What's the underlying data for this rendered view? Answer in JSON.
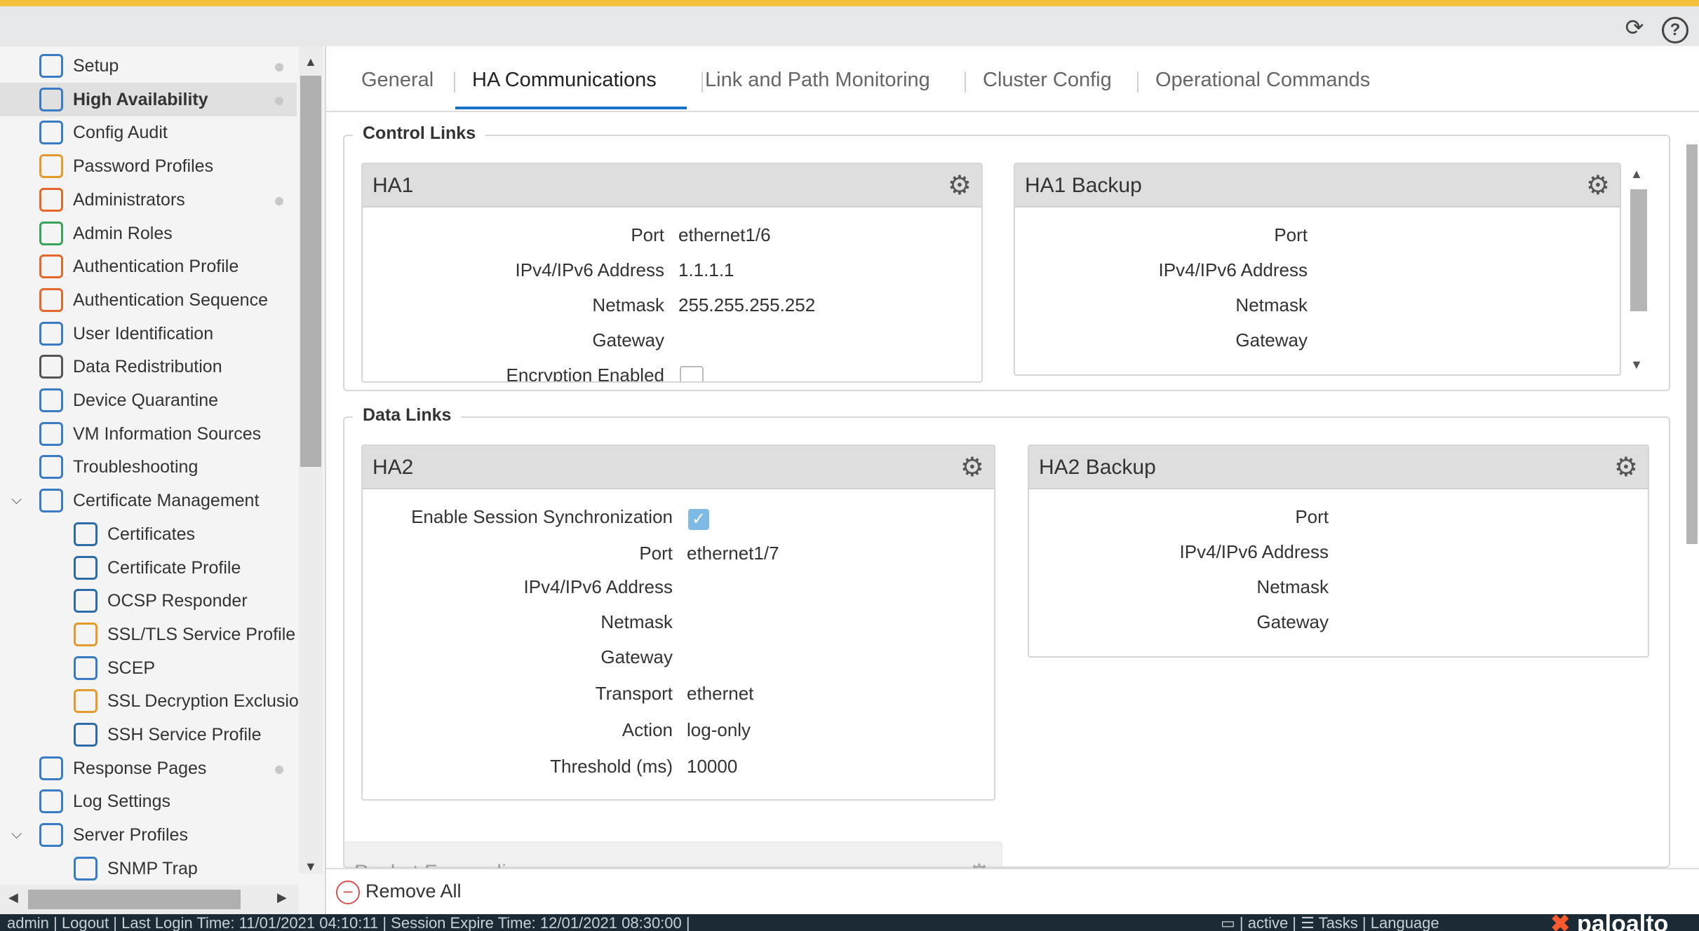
{
  "sidebar": {
    "items": [
      {
        "label": "Setup",
        "icon": "setup-icon",
        "color": "#3a7cc4",
        "dot": true
      },
      {
        "label": "High Availability",
        "icon": "high-availability-icon",
        "color": "#3a7cc4",
        "dot": true,
        "active": true
      },
      {
        "label": "Config Audit",
        "icon": "config-audit-icon",
        "color": "#3a7cc4"
      },
      {
        "label": "Password Profiles",
        "icon": "password-profiles-icon",
        "color": "#e59b2b"
      },
      {
        "label": "Administrators",
        "icon": "administrators-icon",
        "color": "#e5672b",
        "dot": true
      },
      {
        "label": "Admin Roles",
        "icon": "admin-roles-icon",
        "color": "#3aa35a"
      },
      {
        "label": "Authentication Profile",
        "icon": "authentication-profile-icon",
        "color": "#e5672b"
      },
      {
        "label": "Authentication Sequence",
        "icon": "authentication-sequence-icon",
        "color": "#e5672b"
      },
      {
        "label": "User Identification",
        "icon": "user-identification-icon",
        "color": "#3a7cc4"
      },
      {
        "label": "Data Redistribution",
        "icon": "data-redistribution-icon",
        "color": "#555555"
      },
      {
        "label": "Device Quarantine",
        "icon": "device-quarantine-icon",
        "color": "#3a7cc4"
      },
      {
        "label": "VM Information Sources",
        "icon": "vm-information-sources-icon",
        "color": "#3a7cc4"
      },
      {
        "label": "Troubleshooting",
        "icon": "troubleshooting-icon",
        "color": "#3a7cc4"
      },
      {
        "label": "Certificate Management",
        "icon": "certificate-management-icon",
        "color": "#3a7cc4",
        "caret": "⌵"
      },
      {
        "label": "Certificates",
        "icon": "certificates-icon",
        "color": "#2e6ca8",
        "indent": true
      },
      {
        "label": "Certificate Profile",
        "icon": "certificate-profile-icon",
        "color": "#2e6ca8",
        "indent": true
      },
      {
        "label": "OCSP Responder",
        "icon": "ocsp-responder-icon",
        "color": "#2e6ca8",
        "indent": true
      },
      {
        "label": "SSL/TLS Service Profile",
        "icon": "ssl-tls-lock-icon",
        "color": "#e59b2b",
        "indent": true
      },
      {
        "label": "SCEP",
        "icon": "scep-icon",
        "color": "#3a7cc4",
        "indent": true
      },
      {
        "label": "SSL Decryption Exclusio",
        "icon": "ssl-decryption-lock-icon",
        "color": "#e59b2b",
        "indent": true
      },
      {
        "label": "SSH Service Profile",
        "icon": "ssh-service-profile-icon",
        "color": "#2e6ca8",
        "indent": true
      },
      {
        "label": "Response Pages",
        "icon": "response-pages-icon",
        "color": "#3a7cc4",
        "dot": true
      },
      {
        "label": "Log Settings",
        "icon": "log-settings-icon",
        "color": "#3a7cc4"
      },
      {
        "label": "Server Profiles",
        "icon": "server-profiles-icon",
        "color": "#3a7cc4",
        "caret": "⌵"
      },
      {
        "label": "SNMP Trap",
        "icon": "snmp-trap-icon",
        "color": "#3a7cc4",
        "indent": true
      }
    ]
  },
  "tabs": [
    "General",
    "HA Communications",
    "Link and Path Monitoring",
    "Cluster Config",
    "Operational Commands"
  ],
  "control_links": {
    "legend": "Control Links",
    "ha1": {
      "title": "HA1",
      "port_label": "Port",
      "port": "ethernet1/6",
      "addr_label": "IPv4/IPv6 Address",
      "addr": "1.1.1.1",
      "netmask_label": "Netmask",
      "netmask": "255.255.255.252",
      "gateway_label": "Gateway",
      "gateway": "",
      "encryption_label": "Encryption Enabled"
    },
    "ha1_backup": {
      "title": "HA1 Backup",
      "port_label": "Port",
      "addr_label": "IPv4/IPv6 Address",
      "netmask_label": "Netmask",
      "gateway_label": "Gateway"
    }
  },
  "data_links": {
    "legend": "Data Links",
    "ha2": {
      "title": "HA2",
      "sync_label": "Enable Session Synchronization",
      "sync_checked": true,
      "port_label": "Port",
      "port": "ethernet1/7",
      "addr_label": "IPv4/IPv6 Address",
      "netmask_label": "Netmask",
      "gateway_label": "Gateway",
      "transport_label": "Transport",
      "transport": "ethernet",
      "action_label": "Action",
      "action": "log-only",
      "threshold_label": "Threshold (ms)",
      "threshold": "10000"
    },
    "ha2_backup": {
      "title": "HA2 Backup",
      "port_label": "Port",
      "addr_label": "IPv4/IPv6 Address",
      "netmask_label": "Netmask",
      "gateway_label": "Gateway"
    }
  },
  "packet_forwarding": {
    "title": "Packet Forwarding"
  },
  "footer": {
    "remove_all": "Remove All"
  },
  "statusbar": {
    "left": "admin | Logout | Last Login Time: 11/01/2021 04:10:11 | Session Expire Time: 12/01/2021 08:30:00 |",
    "mid": "▭ | active | ☰ Tasks | Language",
    "logo_mark": "✖",
    "logo_text": "paloalto"
  },
  "colors": {
    "accent": "#1a73c8",
    "top_stripe": "#f5c03b",
    "checkbox": "#7fb9e6"
  }
}
